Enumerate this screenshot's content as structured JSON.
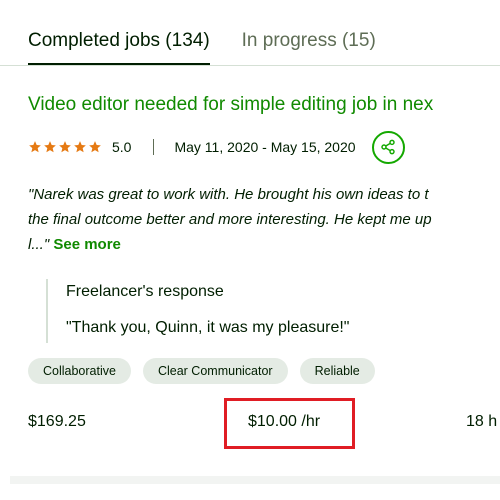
{
  "tabs": [
    {
      "label": "Completed jobs (134)",
      "active": true
    },
    {
      "label": "In progress (15)",
      "active": false
    }
  ],
  "job": {
    "title": "Video editor needed for simple editing job in nex",
    "rating": "5.0",
    "stars": 5,
    "dates": "May 11, 2020 - May 15, 2020",
    "feedback_lines": [
      "\"Narek was great to work with. He brought his own ideas to t",
      "the final outcome better and more interesting. He kept me up",
      "l...\""
    ],
    "see_more": "See more",
    "response_title": "Freelancer's response",
    "response_text": "\"Thank you, Quinn, it was my pleasure!\"",
    "tags": [
      "Collaborative",
      "Clear Communicator",
      "Reliable"
    ],
    "total": "$169.25",
    "rate": "$10.00 /hr",
    "hours": "18 h"
  },
  "colors": {
    "accent_green": "#108a00",
    "star_orange": "#e57a14",
    "highlight_red": "#e01d24"
  },
  "icons": {
    "star": "star-icon",
    "share": "share-icon"
  }
}
